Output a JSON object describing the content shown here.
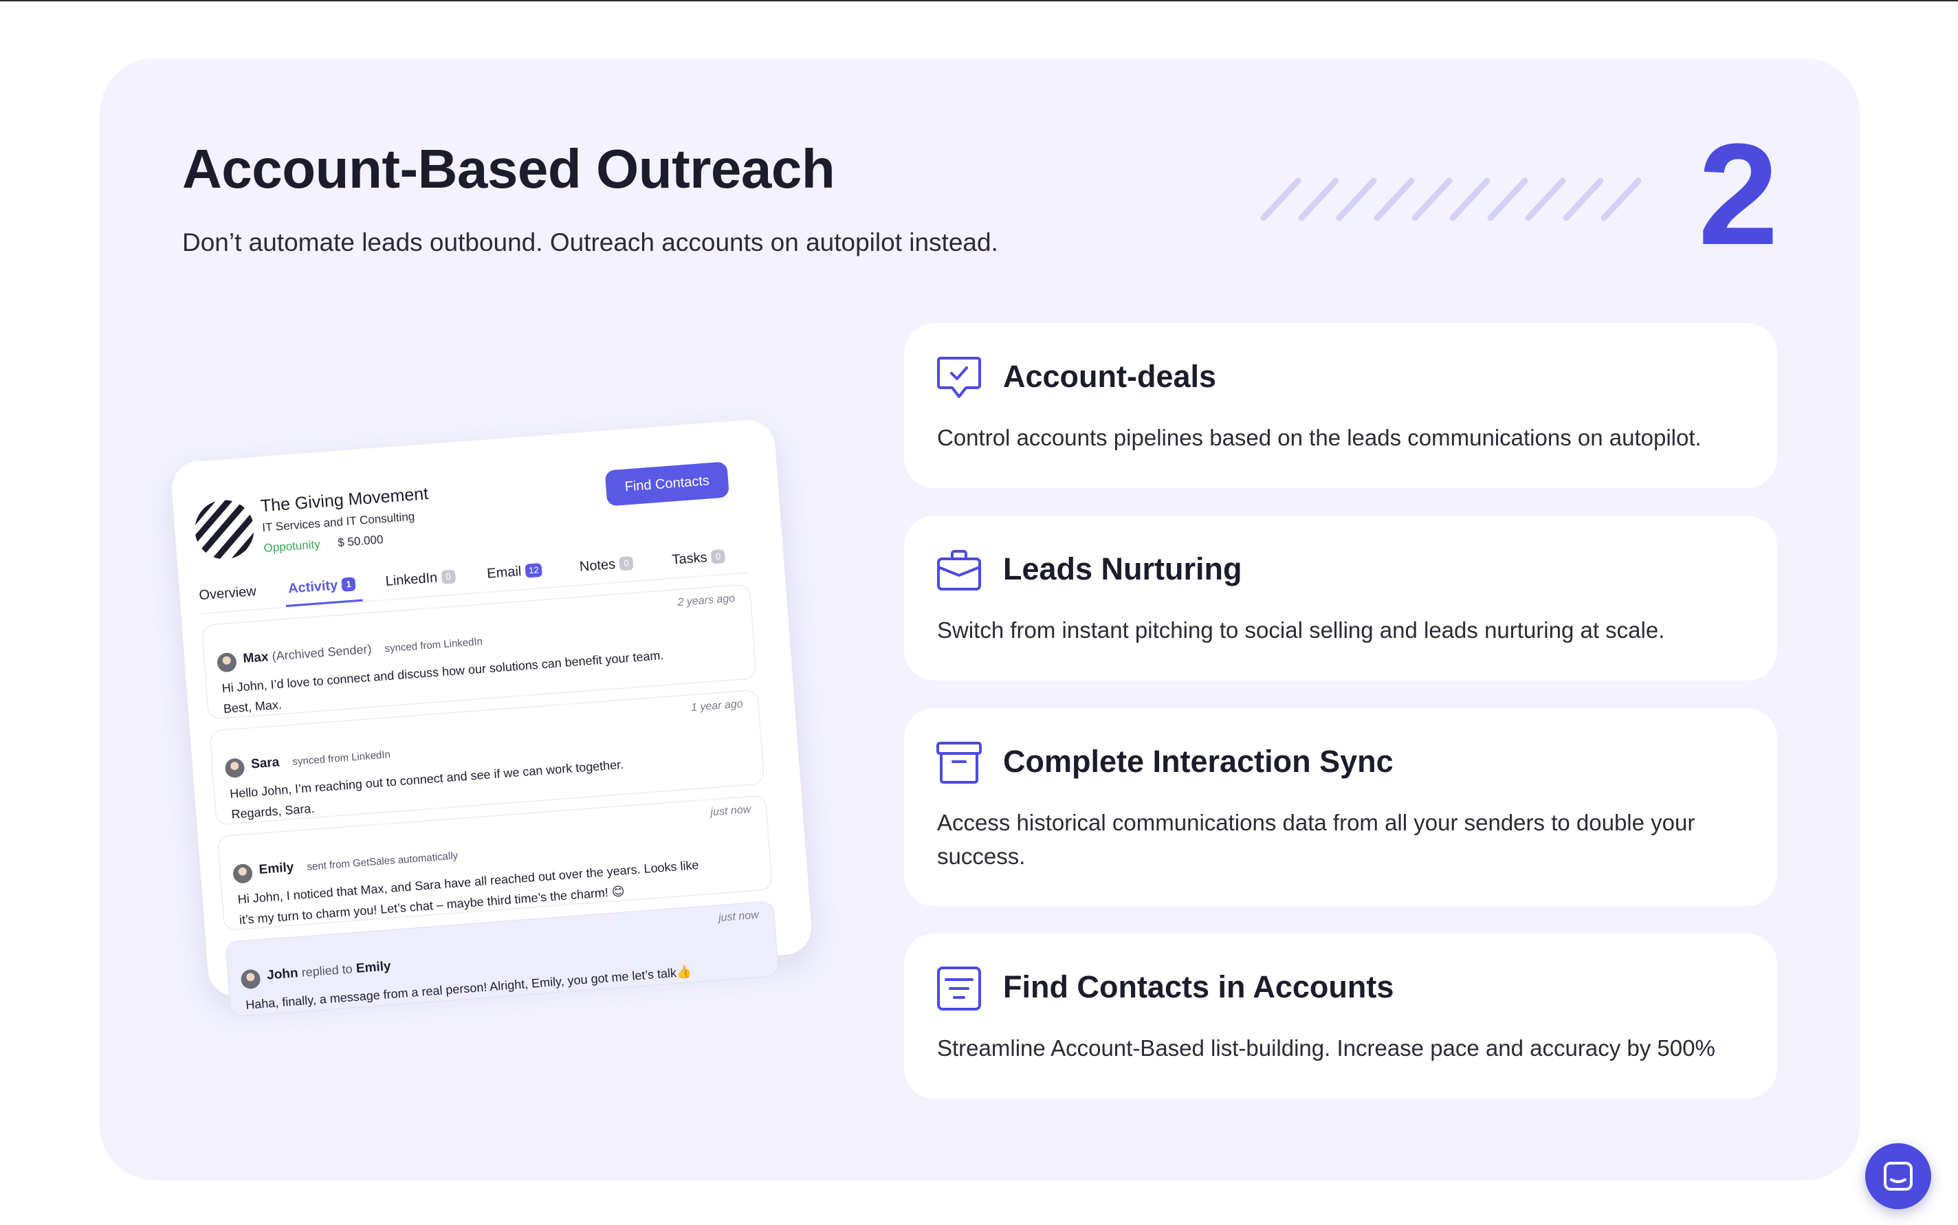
{
  "header": {
    "title": "Account-Based Outreach",
    "subtitle": "Don’t automate leads outbound. Outreach accounts on autopilot instead.",
    "step_number": "2"
  },
  "colors": {
    "accent": "#4b4bdf",
    "panel_background": "#f3f2fe",
    "stripe": "#d3d2f6",
    "opportunity_green": "#33a853"
  },
  "features": [
    {
      "icon": "message-check-icon",
      "title": "Account-deals",
      "description": "Control accounts pipelines based on the leads communications on autopilot."
    },
    {
      "icon": "briefcase-icon",
      "title": "Leads Nurturing",
      "description": "Switch from instant pitching to social selling and leads nurturing at scale."
    },
    {
      "icon": "archive-box-icon",
      "title": "Complete Interaction Sync",
      "description": "Access historical communications data from all your senders to double your success."
    },
    {
      "icon": "filter-list-icon",
      "title": "Find Contacts in Accounts",
      "description": "Streamline Account-Based list-building. Increase pace and accuracy by 500%"
    }
  ],
  "mockup": {
    "company": {
      "name": "The Giving Movement",
      "industry": "IT Services and IT Consulting",
      "stage": "Oppotunity",
      "amount": "$ 50.000"
    },
    "find_contacts_label": "Find Contacts",
    "tabs": [
      {
        "label": "Overview",
        "count": null
      },
      {
        "label": "Activity",
        "count": "1"
      },
      {
        "label": "LinkedIn",
        "count": "0"
      },
      {
        "label": "Email",
        "count": "12"
      },
      {
        "label": "Notes",
        "count": "0"
      },
      {
        "label": "Tasks",
        "count": "0"
      }
    ],
    "active_tab": "Activity",
    "messages": [
      {
        "time": "2 years ago",
        "sender": "Max",
        "sender_note": "(Archived Sender)",
        "source": "synced from LinkedIn",
        "body_line1": "Hi John, I’d love to connect and discuss how our solutions can benefit your team.",
        "body_line2": "Best, Max."
      },
      {
        "time": "1 year ago",
        "sender": "Sara",
        "sender_note": "",
        "source": "synced from LinkedIn",
        "body_line1": "Hello John, I’m reaching out to connect and see if we can work together.",
        "body_line2": "Regards, Sara."
      },
      {
        "time": "just now",
        "sender": "Emily",
        "sender_note": "",
        "source": "sent from GetSales automatically",
        "body_line1": "Hi John, I noticed that Max, and Sara have all reached out over the years. Looks like",
        "body_line2": "it’s my turn to charm you! Let’s chat – maybe third time’s the charm! 😊"
      },
      {
        "time": "just now",
        "sender": "John",
        "replied_to_label": "replied to",
        "replied_to": "Emily",
        "body_line1": "Haha, finally, a message from a real person! Alright, Emily, you got me let’s talk👍"
      }
    ]
  },
  "chat_widget": {
    "icon": "chat-bubble-icon"
  }
}
